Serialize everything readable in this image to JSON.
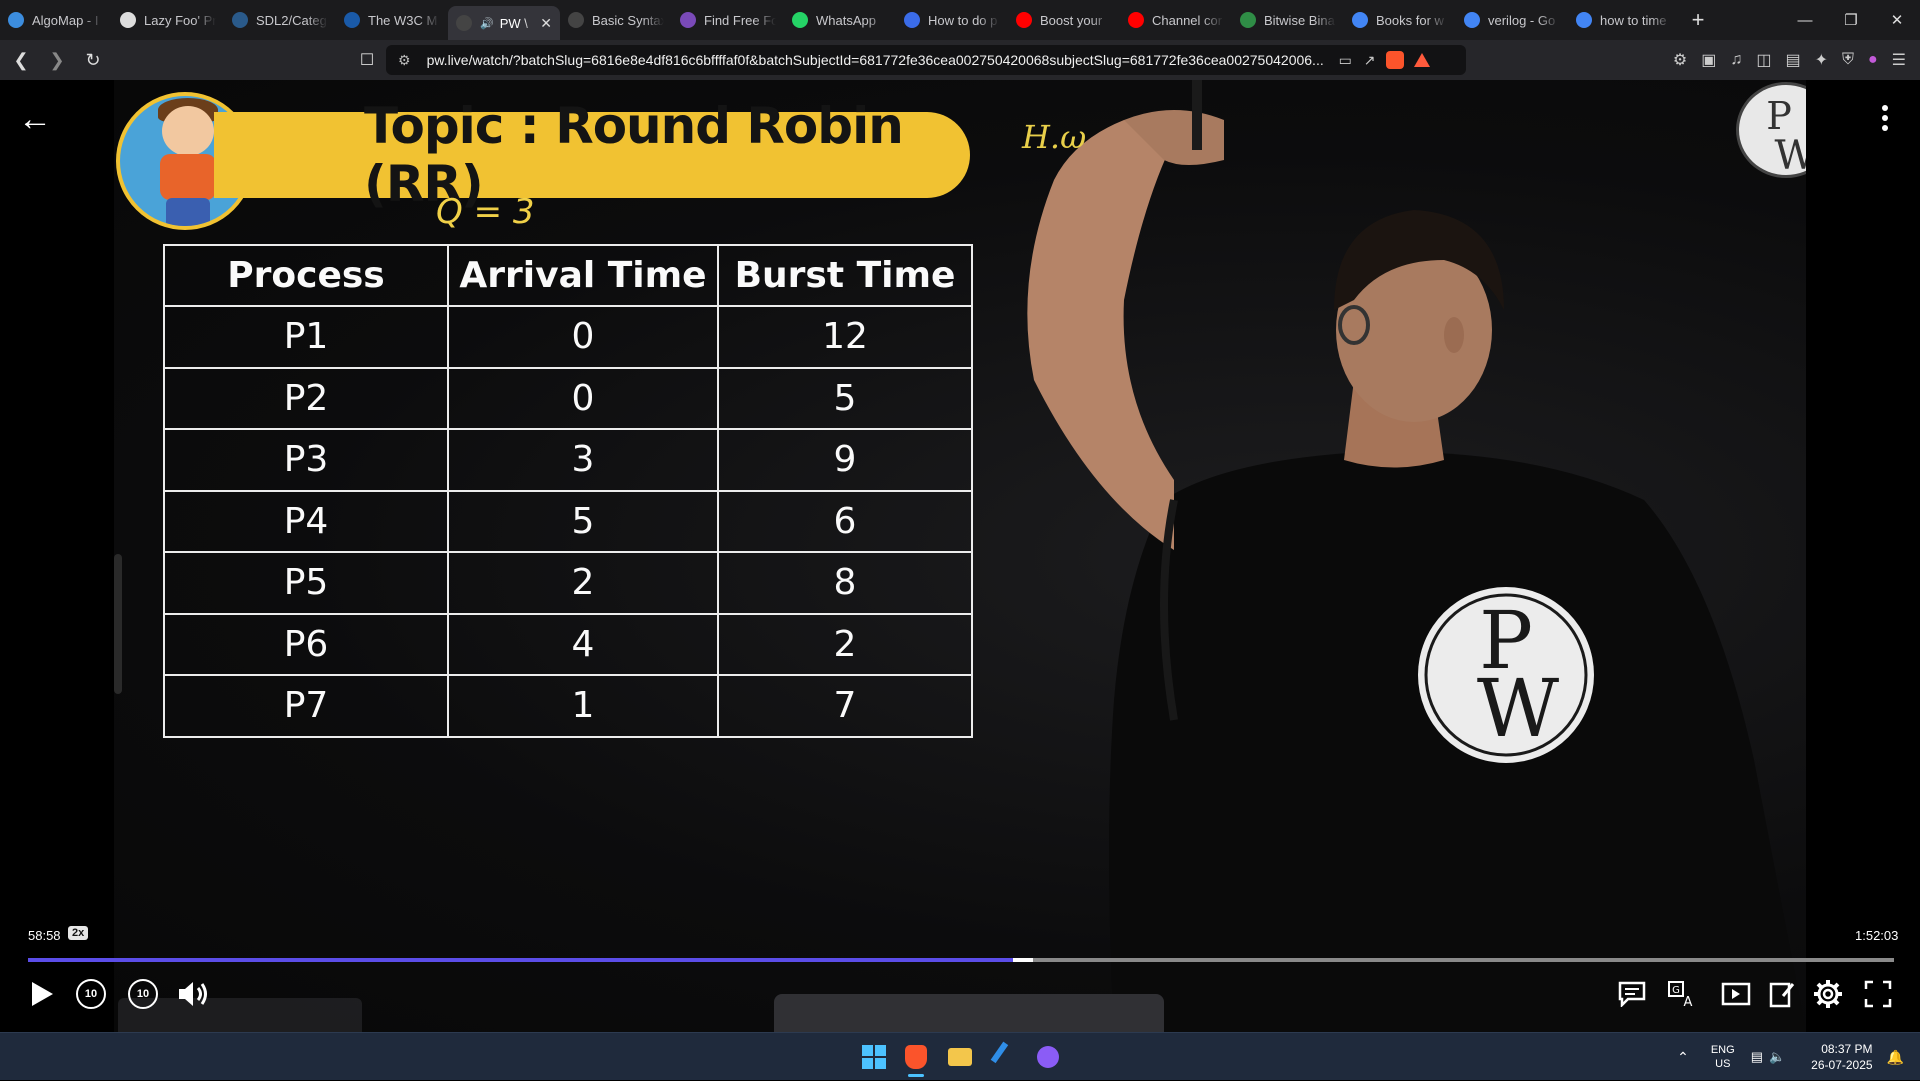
{
  "browser": {
    "tabs": [
      {
        "label": "AlgoMap - I",
        "icon": "algomap-icon",
        "color": "#3c8dde"
      },
      {
        "label": "Lazy Foo' Pr",
        "icon": "lazyfoo-icon",
        "color": "#dddddd"
      },
      {
        "label": "SDL2/Categ",
        "icon": "sdl-icon",
        "color": "#2a5a8a"
      },
      {
        "label": "The W3C M",
        "icon": "w3c-icon",
        "color": "#1a5aa8"
      },
      {
        "label": "PW \\",
        "icon": "pw-icon",
        "color": "#444444",
        "active": true
      },
      {
        "label": "Basic Syntax",
        "icon": "markdown-icon",
        "color": "#444444"
      },
      {
        "label": "Find Free Fo",
        "icon": "fontspace-icon",
        "color": "#7a4ab8"
      },
      {
        "label": "WhatsApp",
        "icon": "whatsapp-icon",
        "color": "#25d366"
      },
      {
        "label": "How to do p",
        "icon": "copilot-icon",
        "color": "#3b6ce8"
      },
      {
        "label": "Boost your",
        "icon": "youtube-icon",
        "color": "#ff0000"
      },
      {
        "label": "Channel cor",
        "icon": "youtube-icon",
        "color": "#ff0000"
      },
      {
        "label": "Bitwise Bina",
        "icon": "gfg-icon",
        "color": "#2f8d46"
      },
      {
        "label": "Books for w",
        "icon": "google-icon",
        "color": "#4285f4"
      },
      {
        "label": "verilog - Go",
        "icon": "google-icon",
        "color": "#4285f4"
      },
      {
        "label": "how to time",
        "icon": "google-icon",
        "color": "#4285f4"
      }
    ],
    "url": "pw.live/watch/?batchSlug=6816e8e4df816c6bffffaf0f&batchSubjectId=681772fe36cea002750420068subjectSlug=681772fe36cea00275042006...",
    "accent": "#fb542b"
  },
  "lecture": {
    "topic": "Topic : Round Robin (RR)",
    "quantum": "Q = 3",
    "board_note": "H.ω",
    "logo": "PW",
    "table": {
      "headers": [
        "Process",
        "Arrival Time",
        "Burst Time"
      ],
      "rows": [
        [
          "P1",
          "0",
          "12"
        ],
        [
          "P2",
          "0",
          "5"
        ],
        [
          "P3",
          "3",
          "9"
        ],
        [
          "P4",
          "5",
          "6"
        ],
        [
          "P5",
          "2",
          "8"
        ],
        [
          "P6",
          "4",
          "2"
        ],
        [
          "P7",
          "1",
          "7"
        ]
      ]
    }
  },
  "player": {
    "current_time": "58:58",
    "speed": "2x",
    "total_time": "1:52:03",
    "progress": 0.528,
    "progress_color": "#5b4de8",
    "skip_seconds": "10"
  },
  "taskbar": {
    "lang_top": "ENG",
    "lang_bottom": "US",
    "time": "08:37 PM",
    "date": "26-07-2025"
  }
}
